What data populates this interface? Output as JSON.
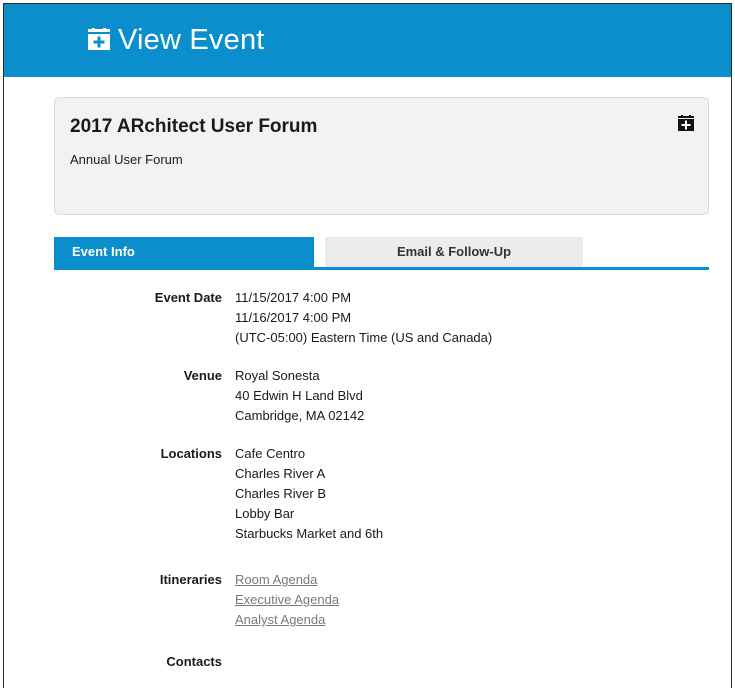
{
  "header": {
    "title": "View Event",
    "icon": "calendar-plus-icon",
    "bg_color": "#0a8fcc"
  },
  "event": {
    "name": "2017 ARchitect User Forum",
    "description": "Annual User Forum",
    "action_icon": "calendar-plus-icon"
  },
  "tabs": [
    {
      "label": "Event Info",
      "active": true
    },
    {
      "label": "Email & Follow-Up",
      "active": false
    }
  ],
  "info": {
    "event_date": {
      "label": "Event Date",
      "start": "11/15/2017 4:00 PM",
      "end": "11/16/2017 4:00 PM",
      "timezone": "(UTC-05:00) Eastern Time (US and Canada)"
    },
    "venue": {
      "label": "Venue",
      "name": "Royal Sonesta",
      "address1": "40 Edwin H Land Blvd",
      "address2": "Cambridge, MA 02142"
    },
    "locations": {
      "label": "Locations",
      "items": [
        "Cafe Centro",
        "Charles River A",
        "Charles River B",
        "Lobby Bar",
        "Starbucks Market and 6th"
      ]
    },
    "itineraries": {
      "label": "Itineraries",
      "items": [
        "Room Agenda",
        "Executive Agenda",
        "Analyst Agenda"
      ]
    },
    "contacts": {
      "label": "Contacts"
    }
  }
}
